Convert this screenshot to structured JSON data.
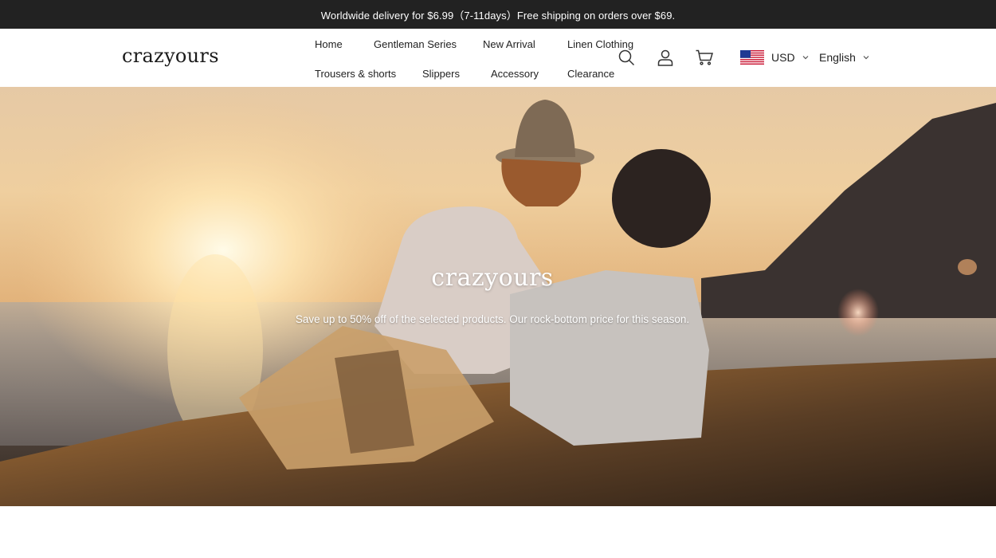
{
  "announcement": {
    "text": "Worldwide delivery for $6.99（7-11days）Free shipping on orders over $69."
  },
  "header": {
    "logo": "crazyours",
    "nav": [
      {
        "label": "Home"
      },
      {
        "label": "Gentleman Series"
      },
      {
        "label": "New Arrival"
      },
      {
        "label": "Linen Clothing"
      },
      {
        "label": "Trousers & shorts"
      },
      {
        "label": "Slippers"
      },
      {
        "label": "Accessory"
      },
      {
        "label": "Clearance"
      }
    ],
    "icons": {
      "search": "search-icon",
      "account": "user-icon",
      "cart": "cart-icon"
    },
    "currency": {
      "flag": "us-flag-icon",
      "value": "USD"
    },
    "language": {
      "value": "English"
    }
  },
  "hero": {
    "title": "crazyours",
    "subtitle": "Save up to 50% off of the selected products. Our rock-bottom price for this season."
  },
  "colors": {
    "announcement_bg": "#222222",
    "announcement_text": "#ffffff",
    "header_bg": "#ffffff",
    "text": "#222222"
  }
}
